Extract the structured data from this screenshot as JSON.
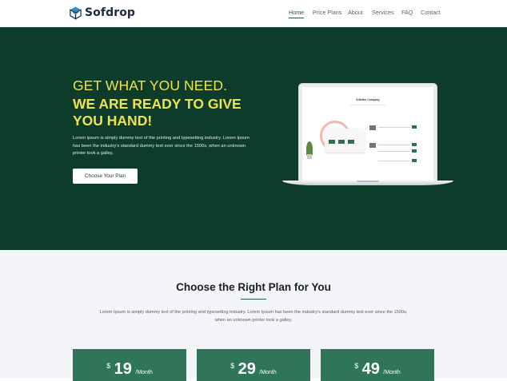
{
  "brand": {
    "name": "Sofdrop",
    "accent": "#1f5a40"
  },
  "nav": {
    "items": [
      {
        "label": "Home",
        "active": true
      },
      {
        "label": "Price Plans",
        "active": false
      },
      {
        "label": "About",
        "active": false
      },
      {
        "label": "Services",
        "active": false
      },
      {
        "label": "FAQ",
        "active": false
      },
      {
        "label": "Contact",
        "active": false
      }
    ]
  },
  "hero": {
    "title_line1": "GET WHAT YOU NEED.",
    "title_line2": "WE ARE READY TO GIVE YOU HAND!",
    "description": "Lorem ipsum is simply dummy text of the printing and typesetting industry. Lorem Ipsum has been the industry's standard dummy text ever since the 1500s, when an unknown printer took a galley.",
    "cta_label": "Choose Your Plan",
    "background": "#0d3d2a",
    "title_color": "#f0e24c",
    "mockup_title": "A Better Company"
  },
  "pricing": {
    "title": "Choose the Right Plan for You",
    "description": "Lorem Ipsum is simply dummy text of the printing and typesetting industry. Lorem Ipsum has been the industry's standard dummy text ever since the 1500s, when an unknown printer took a galley.",
    "plans": [
      {
        "currency": "$",
        "amount": "19",
        "period": "/Month"
      },
      {
        "currency": "$",
        "amount": "29",
        "period": "/Month"
      },
      {
        "currency": "$",
        "amount": "49",
        "period": "/Month"
      }
    ],
    "card_color": "#2e7559"
  }
}
